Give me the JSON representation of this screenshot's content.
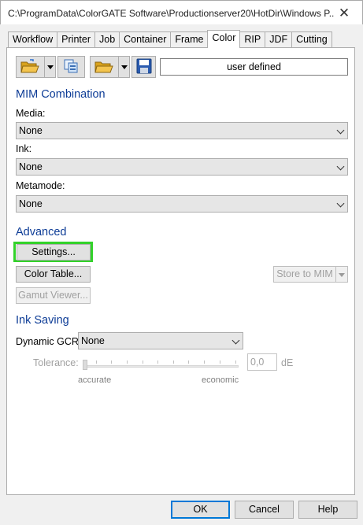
{
  "window": {
    "title": "C:\\ProgramData\\ColorGATE Software\\Productionserver20\\HotDir\\Windows P...",
    "close_glyph": "✕"
  },
  "tabs": [
    {
      "label": "Workflow",
      "active": false
    },
    {
      "label": "Printer",
      "active": false
    },
    {
      "label": "Job",
      "active": false
    },
    {
      "label": "Container",
      "active": false
    },
    {
      "label": "Frame",
      "active": false
    },
    {
      "label": "Color",
      "active": true
    },
    {
      "label": "RIP",
      "active": false
    },
    {
      "label": "JDF",
      "active": false
    },
    {
      "label": "Cutting",
      "active": false
    }
  ],
  "toolbar": {
    "icons": [
      "open-folder-icon",
      "copy-files-icon",
      "open-folder-icon",
      "save-disk-icon"
    ],
    "preset_name": "user defined"
  },
  "mim": {
    "heading": "MIM Combination",
    "media_label": "Media:",
    "media_value": "None",
    "ink_label": "Ink:",
    "ink_value": "None",
    "metamode_label": "Metamode:",
    "metamode_value": "None"
  },
  "advanced": {
    "heading": "Advanced",
    "settings_label": "Settings...",
    "color_table_label": "Color Table...",
    "gamut_viewer_label": "Gamut Viewer...",
    "store_to_mim_label": "Store to MIM"
  },
  "ink_saving": {
    "heading": "Ink Saving",
    "gcr_label": "Dynamic GCR:",
    "gcr_value": "None",
    "tolerance_label": "Tolerance:",
    "tolerance_value": "0,0",
    "tolerance_unit": "dE",
    "slider_min_label": "accurate",
    "slider_max_label": "economic",
    "slider_position": 0
  },
  "footer": {
    "ok_label": "OK",
    "cancel_label": "Cancel",
    "help_label": "Help"
  },
  "colors": {
    "section_heading": "#0d3c96",
    "highlight": "#32d22a",
    "default_button_border": "#0078d7"
  }
}
